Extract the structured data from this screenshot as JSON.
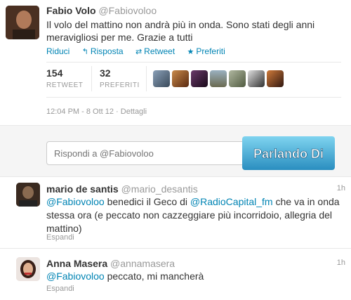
{
  "main_tweet": {
    "author_name": "Fabio Volo",
    "author_handle": "@Fabiovoloo",
    "text": "Il volo del mattino non andrà più in onda. Sono stati degli anni meravigliosi per me. Grazie a tutti",
    "actions": {
      "collapse": "Riduci",
      "reply": "Risposta",
      "retweet": "Retweet",
      "favorite": "Preferiti"
    },
    "stats": {
      "retweets_count": "154",
      "retweets_label": "RETWEET",
      "favorites_count": "32",
      "favorites_label": "PREFERITI"
    },
    "timestamp": "12:04 PM - 8 Ott 12 · Dettagli"
  },
  "reply_box": {
    "placeholder": "Rispondi a @Fabiovoloo"
  },
  "watermark": {
    "text": "Parlando Di"
  },
  "replies": [
    {
      "name": "mario de santis",
      "handle": "@mario_desantis",
      "time": "1h",
      "mention": "@Fabiovoloo",
      "text_1": " benedici il Geco di ",
      "mention_2": "@RadioCapital_fm",
      "text_2": " che va in onda stessa ora (e peccato non cazzeggiare più incorridoio, allegria del mattino)",
      "expand": "Espandi"
    },
    {
      "name": "Anna Masera",
      "handle": "@annamasera",
      "time": "1h",
      "mention": "@Fabiovoloo",
      "text_1": " peccato, mi mancherà",
      "expand": "Espandi"
    }
  ],
  "colors": {
    "link": "#0084b4",
    "muted": "#999999",
    "text": "#333333"
  },
  "icons": [
    "reply-arrow-icon",
    "retweet-icon",
    "star-icon"
  ]
}
